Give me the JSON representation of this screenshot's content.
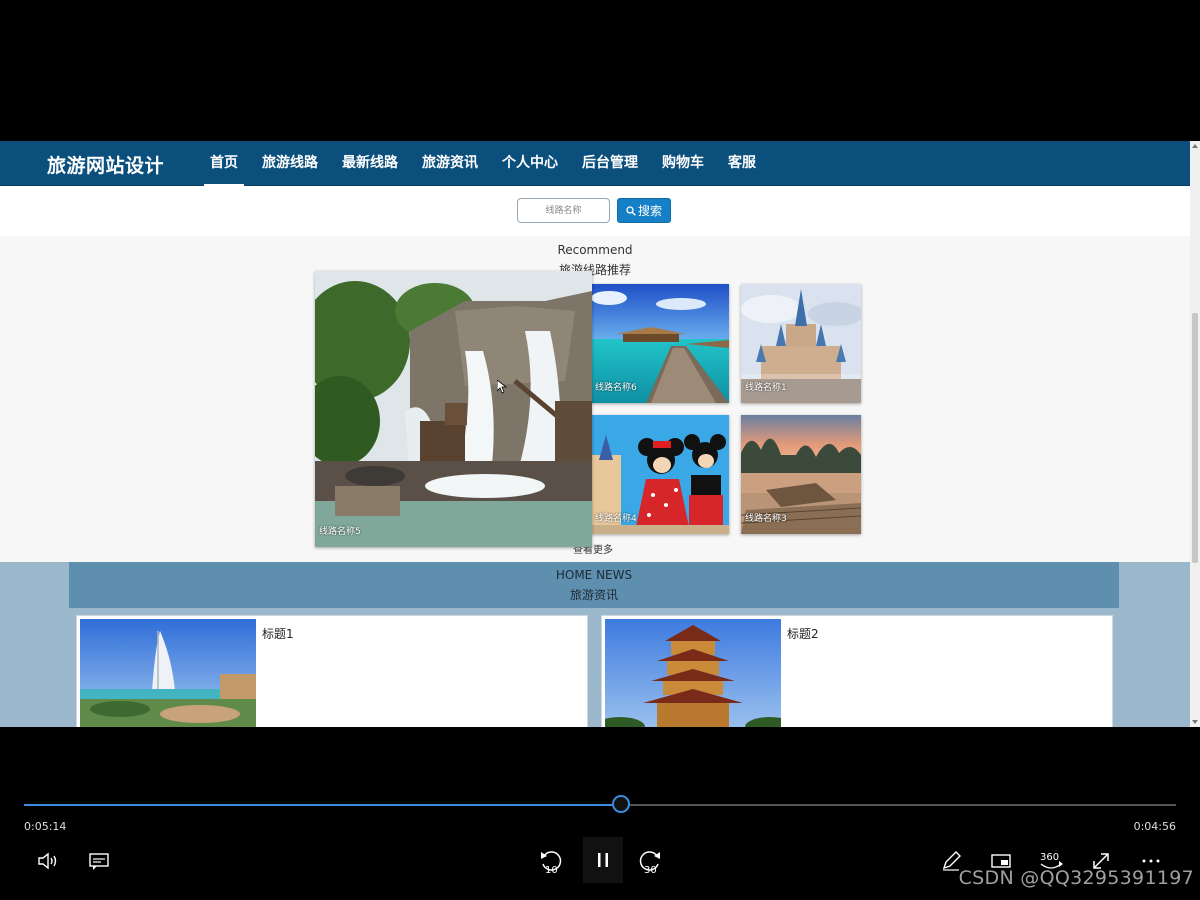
{
  "site": {
    "brand": "旅游网站设计",
    "nav": [
      {
        "label": "首页",
        "active": true
      },
      {
        "label": "旅游线路"
      },
      {
        "label": "最新线路"
      },
      {
        "label": "旅游资讯"
      },
      {
        "label": "个人中心"
      },
      {
        "label": "后台管理"
      },
      {
        "label": "购物车"
      },
      {
        "label": "客服"
      }
    ]
  },
  "search": {
    "placeholder": "线路名称",
    "button_label": "搜索",
    "button_icon": "search-icon"
  },
  "recommend": {
    "title_en": "Recommend",
    "title_cn": "旅游线路推荐",
    "cards": [
      {
        "label": "线路名称5",
        "image": "waterfall-ride"
      },
      {
        "label": "线路名称6",
        "image": "overwater-pier"
      },
      {
        "label": "线路名称1",
        "image": "fairytale-castle"
      },
      {
        "label": "线路名称4",
        "image": "mouse-characters"
      },
      {
        "label": "线路名称3",
        "image": "river-bamboo-raft"
      }
    ],
    "view_more": "查看更多"
  },
  "news": {
    "title_en": "HOME NEWS",
    "title_cn": "旅游资讯",
    "items": [
      {
        "title": "标题1",
        "image": "sail-hotel-coast"
      },
      {
        "title": "标题2",
        "image": "pagoda-tower"
      }
    ]
  },
  "player": {
    "elapsed": "0:05:14",
    "remaining": "0:04:56",
    "progress_fraction": 0.518,
    "skip_back": "10",
    "skip_forward": "30",
    "badge_360": "360",
    "accent_color": "#3b8de0",
    "icons": [
      "volume-icon",
      "subtitles-icon",
      "skip-back-icon",
      "pause-icon",
      "skip-forward-icon",
      "pen-icon",
      "mini-view-icon",
      "360-icon",
      "fullscreen-icon",
      "more-icon"
    ]
  },
  "watermark": "CSDN @QQ3295391197"
}
